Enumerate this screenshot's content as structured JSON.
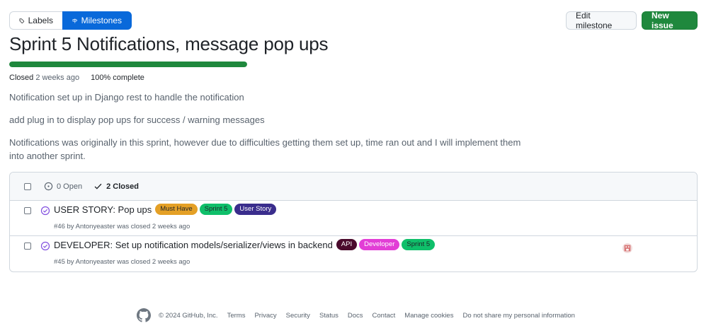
{
  "nav": {
    "labels_label": "Labels",
    "milestones_label": "Milestones"
  },
  "actions": {
    "edit_label": "Edit milestone",
    "new_issue_label": "New issue"
  },
  "milestone": {
    "title": "Sprint 5 Notifications, message pop ups",
    "progress_percent": 100,
    "state_label": "Closed",
    "closed_when": "2 weeks ago",
    "complete_text": "100% complete",
    "description": [
      "Notification set up in Django rest to handle the notification",
      "add plug in to display pop ups for success / warning messages",
      "Notifications was originally in this sprint, however due to difficulties getting them set up, time ran out and I will implement them into another sprint."
    ]
  },
  "issues_header": {
    "open_text": "0 Open",
    "closed_text": "2 Closed"
  },
  "issues": [
    {
      "title": "USER STORY: Pop ups",
      "labels": [
        {
          "text": "Must Have",
          "bg": "#e4a026",
          "fg": "#1f2328"
        },
        {
          "text": "Sprint 5",
          "bg": "#0fbf6a",
          "fg": "#1f2328"
        },
        {
          "text": "User Story",
          "bg": "#3a2d8c",
          "fg": "#ffffff"
        }
      ],
      "meta": "#46 by Antonyeaster was closed 2 weeks ago",
      "has_avatar": false
    },
    {
      "title": "DEVELOPER: Set up notification models/serializer/views in backend",
      "labels": [
        {
          "text": "API",
          "bg": "#4a0a2c",
          "fg": "#ffffff"
        },
        {
          "text": "Developer",
          "bg": "#e23ed6",
          "fg": "#ffffff"
        },
        {
          "text": "Sprint 5",
          "bg": "#0fbf6a",
          "fg": "#1f2328"
        }
      ],
      "meta": "#45 by Antonyeaster was closed 2 weeks ago",
      "has_avatar": true
    }
  ],
  "footer": {
    "copyright": "© 2024 GitHub, Inc.",
    "links": [
      "Terms",
      "Privacy",
      "Security",
      "Status",
      "Docs",
      "Contact",
      "Manage cookies",
      "Do not share my personal information"
    ]
  },
  "colors": {
    "accent_blue": "#0969da",
    "success_green": "#1f883d",
    "done_purple": "#8250df"
  }
}
